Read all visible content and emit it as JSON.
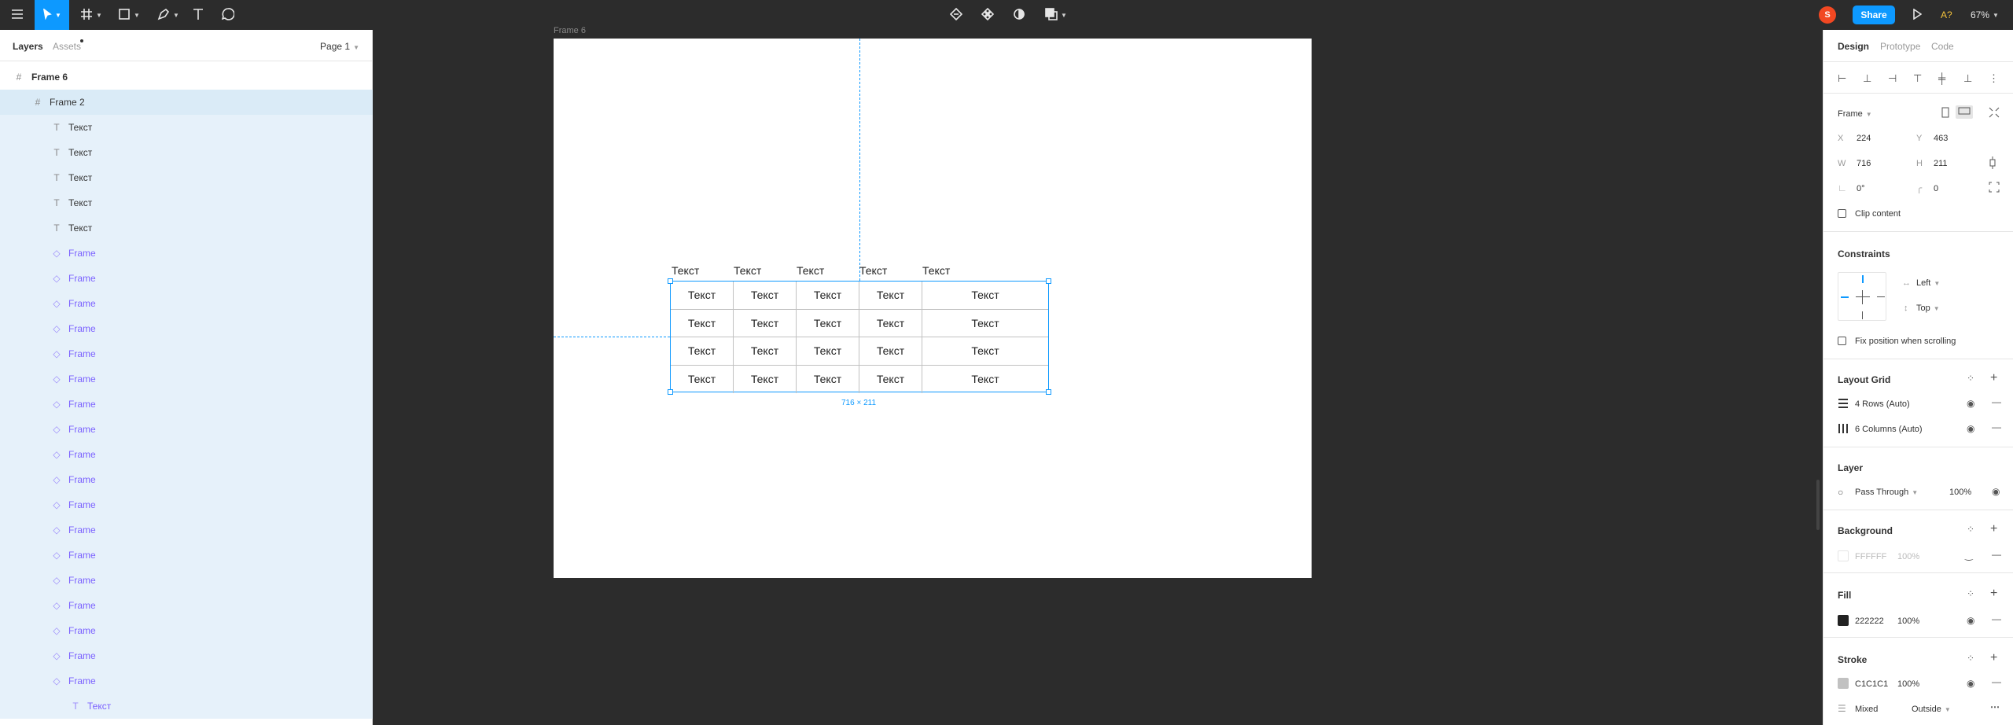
{
  "toolbar": {
    "share_label": "Share",
    "avatar_initial": "S",
    "ai_label": "A?",
    "zoom": "67%"
  },
  "left_panel": {
    "tab_layers": "Layers",
    "tab_assets": "Assets",
    "page": "Page 1",
    "layers": [
      {
        "label": "Frame 6"
      },
      {
        "label": "Frame 2"
      },
      {
        "label": "Текст"
      },
      {
        "label": "Текст"
      },
      {
        "label": "Текст"
      },
      {
        "label": "Текст"
      },
      {
        "label": "Текст"
      },
      {
        "label": "Frame"
      },
      {
        "label": "Frame"
      },
      {
        "label": "Frame"
      },
      {
        "label": "Frame"
      },
      {
        "label": "Frame"
      },
      {
        "label": "Frame"
      },
      {
        "label": "Frame"
      },
      {
        "label": "Frame"
      },
      {
        "label": "Frame"
      },
      {
        "label": "Frame"
      },
      {
        "label": "Frame"
      },
      {
        "label": "Frame"
      },
      {
        "label": "Frame"
      },
      {
        "label": "Frame"
      },
      {
        "label": "Frame"
      },
      {
        "label": "Frame"
      },
      {
        "label": "Frame"
      },
      {
        "label": "Frame"
      },
      {
        "label": "Текст"
      }
    ]
  },
  "canvas": {
    "frame_label": "Frame 6",
    "header_texts": [
      "Текст",
      "Текст",
      "Текст",
      "Текст",
      "Текст"
    ],
    "table": {
      "rows": [
        [
          "Текст",
          "Текст",
          "Текст",
          "Текст",
          "Текст"
        ],
        [
          "Текст",
          "Текст",
          "Текст",
          "Текст",
          "Текст"
        ],
        [
          "Текст",
          "Текст",
          "Текст",
          "Текст",
          "Текст"
        ],
        [
          "Текст",
          "Текст",
          "Текст",
          "Текст",
          "Текст"
        ]
      ]
    },
    "dimension_label": "716 × 211"
  },
  "right_panel": {
    "tabs": {
      "design": "Design",
      "prototype": "Prototype",
      "code": "Code"
    },
    "frame_type": "Frame",
    "x_label": "X",
    "x": "224",
    "y_label": "Y",
    "y": "463",
    "w_label": "W",
    "w": "716",
    "h_label": "H",
    "h": "211",
    "rotation": "0°",
    "radius": "0",
    "clip_content": "Clip content",
    "constraints_title": "Constraints",
    "constraint_h": "Left",
    "constraint_v": "Top",
    "fix_position": "Fix position when scrolling",
    "layout_grid_title": "Layout Grid",
    "grid_rows": "4 Rows (Auto)",
    "grid_cols": "6 Columns (Auto)",
    "layer_title": "Layer",
    "blend": "Pass Through",
    "layer_opacity": "100%",
    "background_title": "Background",
    "bg_hex": "FFFFFF",
    "bg_opacity": "100%",
    "fill_title": "Fill",
    "fill_hex": "222222",
    "fill_opacity": "100%",
    "stroke_title": "Stroke",
    "stroke_hex": "C1C1C1",
    "stroke_opacity": "100%",
    "stroke_weight": "Mixed",
    "stroke_position": "Outside"
  },
  "colors": {
    "accent": "#0d99ff",
    "fill": "#222222",
    "stroke": "#c1c1c1",
    "avatar": "#f24822"
  }
}
